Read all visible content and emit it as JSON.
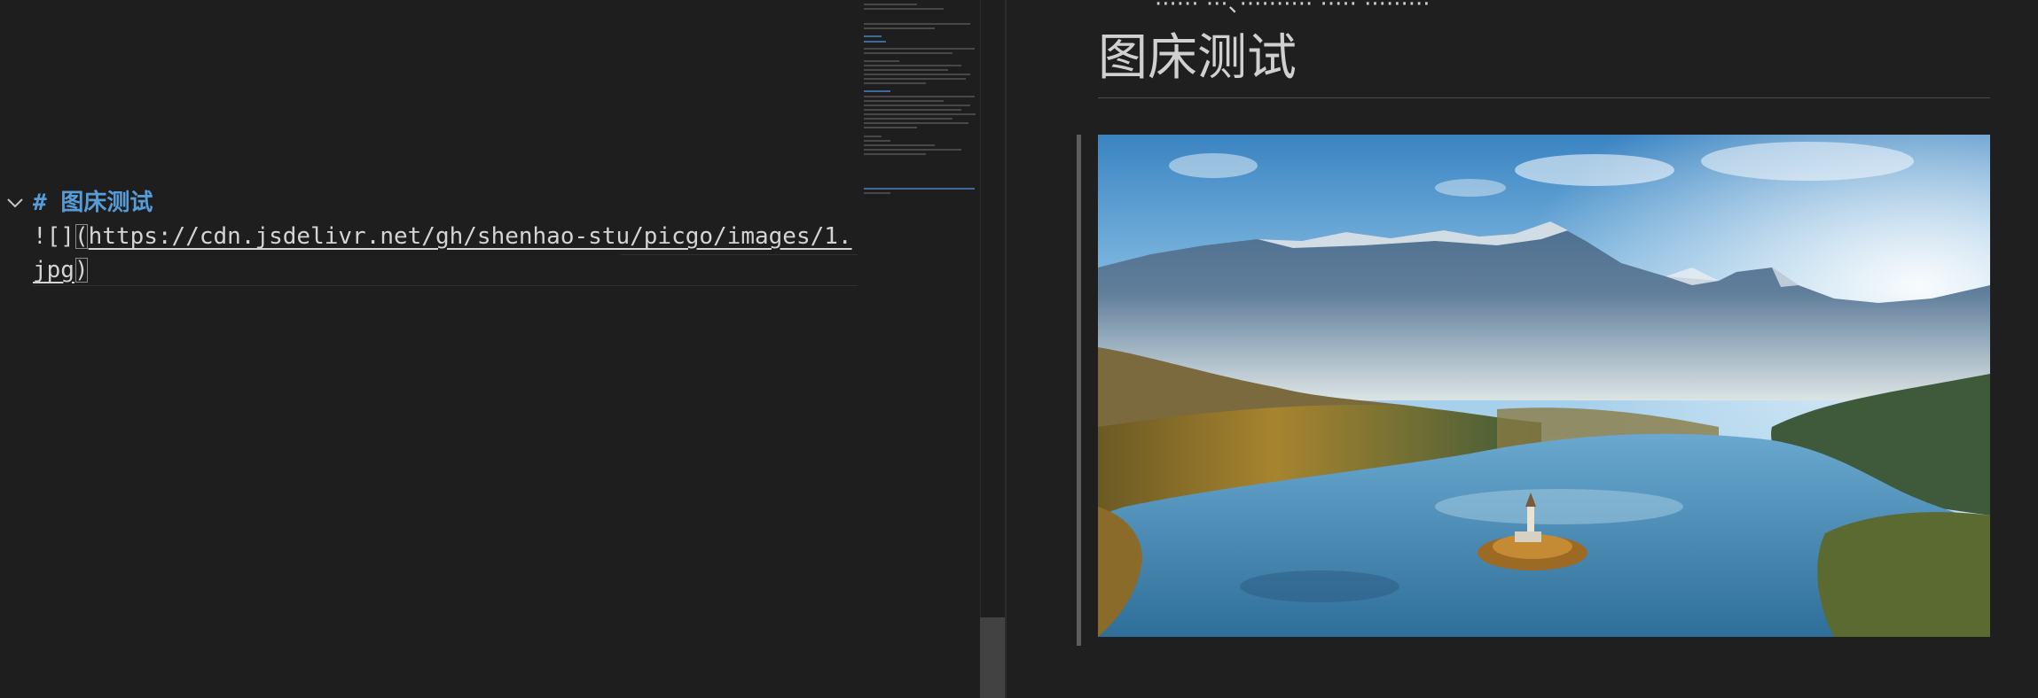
{
  "editor": {
    "heading_marker": "#",
    "heading_text": "图床测试",
    "image_prefix": "![]",
    "open_paren": "(",
    "url_line1": "https://cdn.jsdelivr.net/gh/shenhao-stu/picgo/images/1.",
    "url_line2": "jpg",
    "close_paren": ")"
  },
  "preview": {
    "partial_line": "······ ···、·········· ····· ·········",
    "title": "图床测试"
  },
  "colors": {
    "background": "#1e1e1e",
    "heading": "#569cd6",
    "text": "#d4d4d4"
  }
}
